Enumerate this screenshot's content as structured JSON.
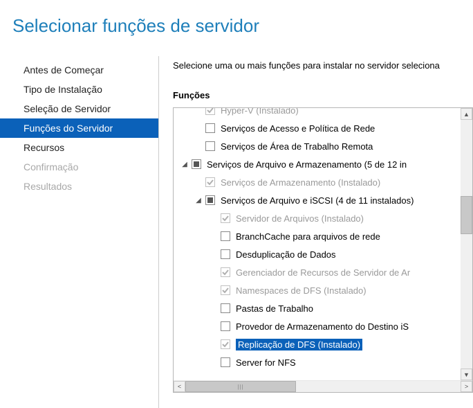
{
  "title": "Selecionar funções de servidor",
  "instruction": "Selecione uma ou mais funções para instalar no servidor seleciona",
  "section_label": "Funções",
  "sidebar": {
    "items": [
      {
        "label": "Antes de Começar",
        "state": "normal"
      },
      {
        "label": "Tipo de Instalação",
        "state": "normal"
      },
      {
        "label": "Seleção de Servidor",
        "state": "normal"
      },
      {
        "label": "Funções do Servidor",
        "state": "active"
      },
      {
        "label": "Recursos",
        "state": "normal"
      },
      {
        "label": "Confirmação",
        "state": "disabled"
      },
      {
        "label": "Resultados",
        "state": "disabled"
      }
    ]
  },
  "tree": [
    {
      "level": 1,
      "expander": "none",
      "check": "checked-disabled",
      "label": "Hyper-V (Instalado)",
      "label_state": "disabled"
    },
    {
      "level": 1,
      "expander": "none",
      "check": "unchecked",
      "label": "Serviços de Acesso e Política de Rede"
    },
    {
      "level": 1,
      "expander": "none",
      "check": "unchecked",
      "label": "Serviços de Área de Trabalho Remota"
    },
    {
      "level": 0,
      "expander": "open",
      "check": "indet",
      "label": "Serviços de Arquivo e Armazenamento (5 de 12 in"
    },
    {
      "level": 1,
      "expander": "none",
      "check": "checked-disabled",
      "label": "Serviços de Armazenamento (Instalado)",
      "label_state": "disabled"
    },
    {
      "level": 1,
      "expander": "open",
      "check": "indet",
      "label": "Serviços de Arquivo e iSCSI (4 de 11 instalados)"
    },
    {
      "level": 2,
      "expander": "none",
      "check": "checked-disabled",
      "label": "Servidor de Arquivos (Instalado)",
      "label_state": "disabled"
    },
    {
      "level": 2,
      "expander": "none",
      "check": "unchecked",
      "label": "BranchCache para arquivos de rede"
    },
    {
      "level": 2,
      "expander": "none",
      "check": "unchecked",
      "label": "Desduplicação de Dados"
    },
    {
      "level": 2,
      "expander": "none",
      "check": "checked-disabled",
      "label": "Gerenciador de Recursos de Servidor de Ar",
      "label_state": "disabled"
    },
    {
      "level": 2,
      "expander": "none",
      "check": "checked-disabled",
      "label": "Namespaces de DFS (Instalado)",
      "label_state": "disabled"
    },
    {
      "level": 2,
      "expander": "none",
      "check": "unchecked",
      "label": "Pastas de Trabalho"
    },
    {
      "level": 2,
      "expander": "none",
      "check": "unchecked",
      "label": "Provedor de Armazenamento do Destino iS"
    },
    {
      "level": 2,
      "expander": "none",
      "check": "checked-disabled",
      "label": "Replicação de DFS (Instalado)",
      "label_state": "selected"
    },
    {
      "level": 2,
      "expander": "none",
      "check": "unchecked",
      "label": "Server for NFS"
    }
  ]
}
